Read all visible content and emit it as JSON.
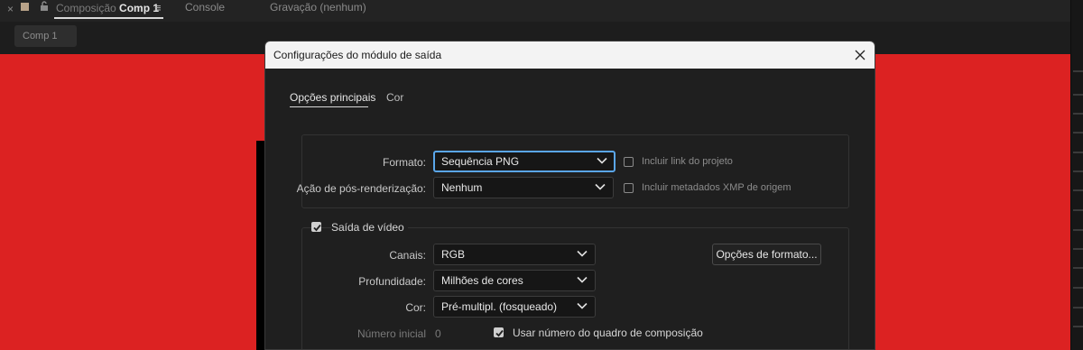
{
  "app": {
    "tabs": {
      "close_glyph": "×",
      "composition_prefix": "Composição",
      "composition_name": "Comp 1",
      "menu_glyph": "≡",
      "console": "Console",
      "recording": "Gravação (nenhum)"
    },
    "comp_chip": "Comp 1",
    "colors": {
      "viewer_background": "#dc2222",
      "focus_ring": "#5aa6ea"
    }
  },
  "dialog": {
    "title": "Configurações do módulo de saída",
    "close_icon": "close-icon",
    "tabs": {
      "main": "Opções principais",
      "color": "Cor"
    },
    "format_group": {
      "format_label": "Formato:",
      "format_value": "Sequência PNG",
      "post_render_label": "Ação de pós-renderização:",
      "post_render_value": "Nenhum",
      "include_project_link": {
        "label": "Incluir link do projeto",
        "checked": false
      },
      "include_xmp": {
        "label": "Incluir metadados XMP de origem",
        "checked": false
      }
    },
    "video_output": {
      "label": "Saída de vídeo",
      "checked": true,
      "channels_label": "Canais:",
      "channels_value": "RGB",
      "depth_label": "Profundidade:",
      "depth_value": "Milhões de cores",
      "color_label": "Cor:",
      "color_value": "Pré-multipl. (fosqueado)",
      "format_options_button": "Opções de formato...",
      "start_number_label": "Número inicial",
      "start_number_value": "0",
      "use_comp_frame_number": {
        "label": "Usar número do quadro de composição",
        "checked": true
      }
    }
  }
}
